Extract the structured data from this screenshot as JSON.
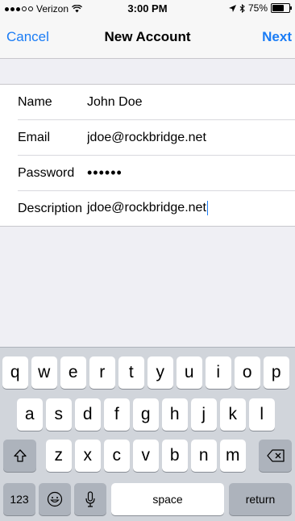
{
  "status_bar": {
    "carrier": "Verizon",
    "time": "3:00 PM",
    "battery": "75%",
    "battery_level": 0.75
  },
  "nav": {
    "cancel": "Cancel",
    "title": "New Account",
    "next": "Next"
  },
  "form": {
    "fields": [
      {
        "label": "Name",
        "value": "John Doe"
      },
      {
        "label": "Email",
        "value": "jdoe@rockbridge.net"
      },
      {
        "label": "Password",
        "value": "••••••"
      },
      {
        "label": "Description",
        "value": "jdoe@rockbridge.net"
      }
    ]
  },
  "keyboard": {
    "row1": [
      "q",
      "w",
      "e",
      "r",
      "t",
      "y",
      "u",
      "i",
      "o",
      "p"
    ],
    "row2": [
      "a",
      "s",
      "d",
      "f",
      "g",
      "h",
      "j",
      "k",
      "l"
    ],
    "row3": [
      "z",
      "x",
      "c",
      "v",
      "b",
      "n",
      "m"
    ],
    "numbers": "123",
    "space": "space",
    "return": "return",
    "icons": {
      "shift": "shift-icon",
      "delete": "delete-icon",
      "emoji": "emoji-icon",
      "mic": "microphone-icon"
    }
  },
  "colors": {
    "accent": "#1a7cf5",
    "background": "#efeff4",
    "keyboard": "#d1d5db"
  }
}
